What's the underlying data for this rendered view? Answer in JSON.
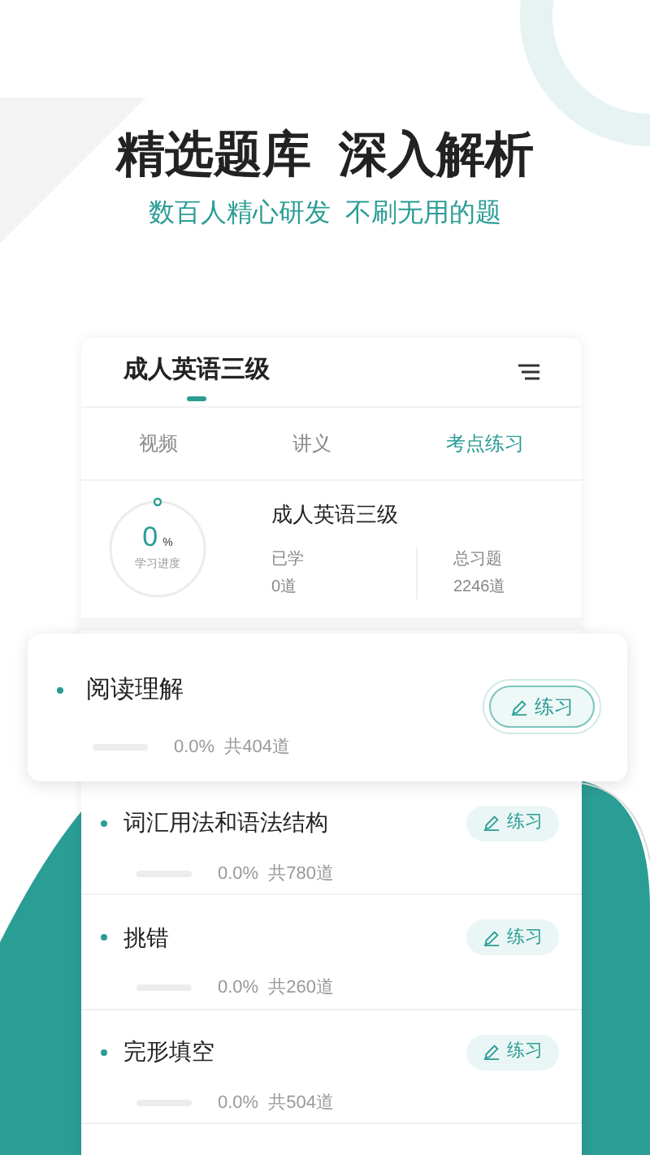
{
  "headline": "精选题库  深入解析",
  "tagline": "数百人精心研发  不刷无用的题",
  "course": {
    "title": "成人英语三级"
  },
  "tabs": [
    {
      "label": "视频",
      "selected": false
    },
    {
      "label": "讲义",
      "selected": false
    },
    {
      "label": "考点练习",
      "selected": true
    }
  ],
  "summary": {
    "progress_value": "0",
    "progress_unit": "%",
    "progress_label": "学习进度",
    "name": "成人英语三级",
    "learned_label": "已学",
    "learned_value": "0道",
    "total_label": "总习题",
    "total_value": "2246道"
  },
  "topics": [
    {
      "kind": "featured",
      "name": "阅读理解",
      "level": 0,
      "percent": "0.0%",
      "count": "共404道",
      "button": "练习"
    },
    {
      "kind": "normal",
      "name": "词汇用法和语法结构",
      "level": 0,
      "percent": "0.0%",
      "count": "共780道",
      "button": "练习"
    },
    {
      "kind": "normal",
      "name": "挑错",
      "level": 0,
      "percent": "0.0%",
      "count": "共260道",
      "button": "练习"
    },
    {
      "kind": "normal",
      "name": "完形填空",
      "level": 0,
      "percent": "0.0%",
      "count": "共504道",
      "button": "练习"
    }
  ]
}
